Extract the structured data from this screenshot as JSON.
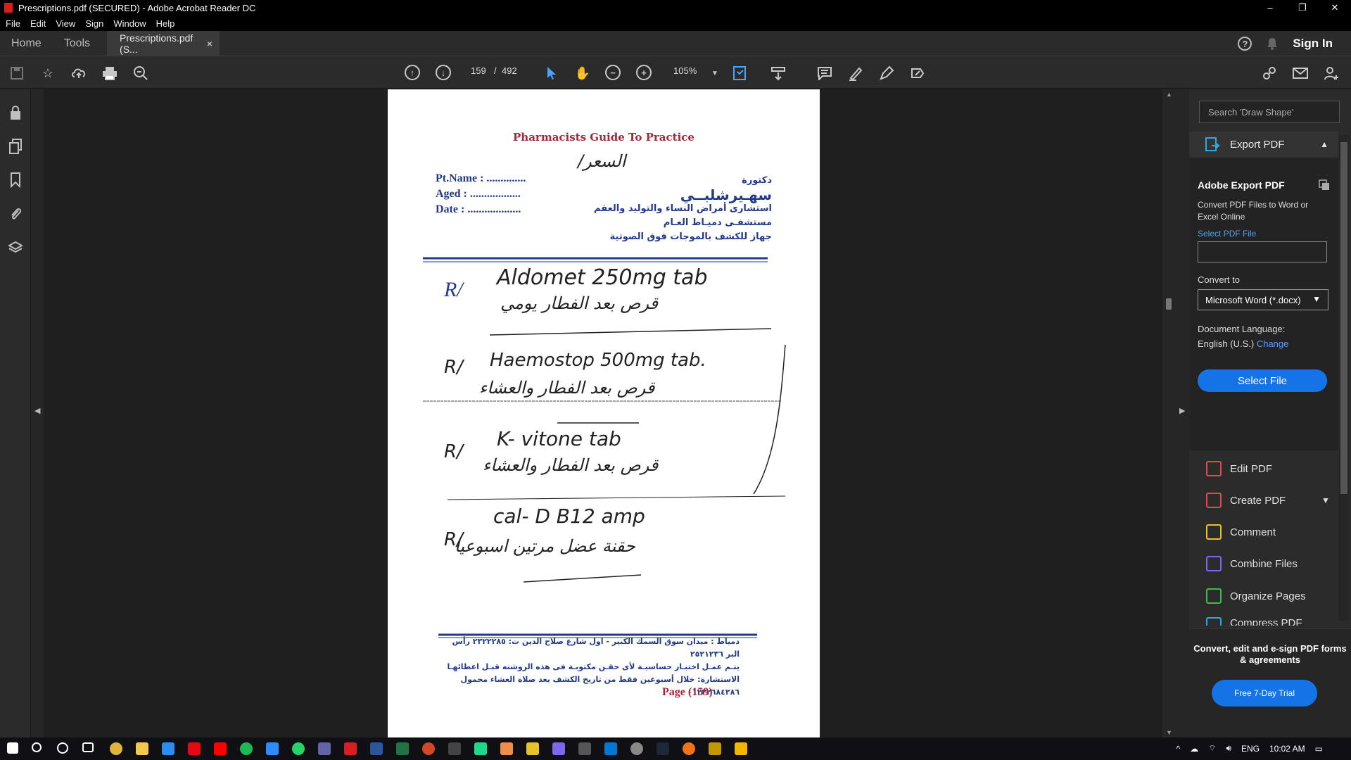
{
  "window": {
    "title": "Prescriptions.pdf (SECURED) - Adobe Acrobat Reader DC",
    "min": "–",
    "max": "❐",
    "close": "✕"
  },
  "menu": [
    "File",
    "Edit",
    "View",
    "Sign",
    "Window",
    "Help"
  ],
  "tabs": {
    "home": "Home",
    "tools": "Tools",
    "document": "Prescriptions.pdf (S...",
    "close": "×",
    "signin": "Sign In",
    "help": "?"
  },
  "toolbar": {
    "page_current": "159",
    "page_sep": "/",
    "page_total": "492",
    "zoom": "105%"
  },
  "panel": {
    "search_placeholder": "Search 'Draw Shape'",
    "export_title": "Export PDF",
    "card_title": "Adobe Export PDF",
    "card_desc": "Convert PDF Files to Word or Excel Online",
    "select_pdf": "Select PDF File",
    "convert_to": "Convert to",
    "format": "Microsoft Word (*.docx)",
    "doc_lang_label": "Document Language:",
    "doc_lang": "English (U.S.)",
    "change": "Change",
    "select_file": "Select File",
    "tools": [
      "Edit PDF",
      "Create PDF",
      "Comment",
      "Combine Files",
      "Organize Pages",
      "Compress PDF"
    ],
    "promo": "Convert, edit and e-sign PDF forms & agreements",
    "trial": "Free 7-Day Trial"
  },
  "colors": {
    "tool_icons": [
      "#e34850",
      "#e34850",
      "#e8c12e",
      "#7b68ee",
      "#3fb950",
      "#2ea8e0"
    ]
  },
  "document": {
    "header": "Pharmacists Guide To Practice",
    "pt_name": "Pt.Name : ..............",
    "aged": "Aged : ..................",
    "date": "Date : ...................",
    "doctor_title": "دكتورة",
    "doctor_name": "سهـيرشلبــي",
    "doctor_line1": "استشارى أمراض النساء والتوليد والعقم",
    "doctor_line2": "مستشفـى دميـاط العـام",
    "doctor_line3": "جهاز للكشف بالموجات فوق الصوتية",
    "handwriting": {
      "top": "السعر/",
      "rx1": "Aldomet 250mg tab",
      "rx1_ar": "قرص بعد الفطار يومي",
      "rx2": "Haemostop 500mg tab.",
      "rx2_ar": "قرص بعد الفطار والعشاء",
      "rx3": "K- vitone tab",
      "rx3_ar": "قرص بعد الفطار والعشاء",
      "rx4": "cal- D B12 amp",
      "rx4_ar": "حقنة عضل مرتين اسبوعيا"
    },
    "footer1": "دمياط : ميدان سوق السمك الكبير - اول شارع صلاح الدين ت: ٢٣٢٢٢٨٥ رأس البر ٢٥٢١٢٣٦",
    "footer2": "يتـم عمـل اختبـار حساسيـة لأى حقـن مكتوبـة فى هذه الروشته قبـل اعطائهـا",
    "footer3": "الاستشارة: خلال أسبوعين فقط من تاريخ الكشف بعد صلاة العشاء  محمول ٠١٢٢٢٦٨٤٢٨٦",
    "page_label": "Page (159)"
  },
  "taskbar": {
    "lang": "ENG",
    "time": "10:02 AM"
  }
}
